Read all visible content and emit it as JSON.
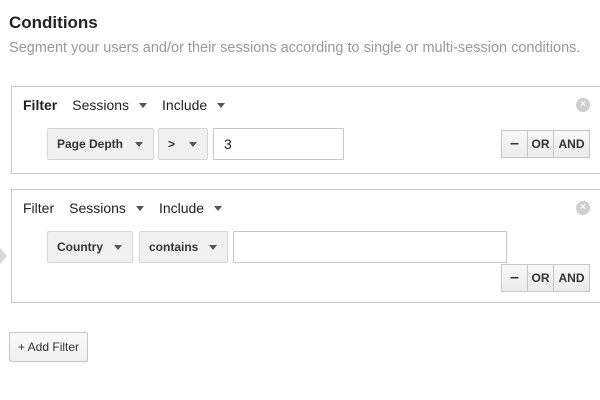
{
  "header": {
    "title": "Conditions",
    "subtitle": "Segment your users and/or their sessions according to single or multi-session conditions."
  },
  "filters": [
    {
      "label": "Filter",
      "scope": "Sessions",
      "mode": "Include",
      "dimension": "Page Depth",
      "operator": ">",
      "value": "3",
      "value_placeholder": "",
      "buttons": {
        "remove": "–",
        "or": "OR",
        "and": "AND"
      }
    },
    {
      "label": "Filter",
      "scope": "Sessions",
      "mode": "Include",
      "dimension": "Country",
      "operator": "contains",
      "value": "",
      "value_placeholder": "",
      "buttons": {
        "remove": "–",
        "or": "OR",
        "and": "AND"
      }
    }
  ],
  "add_filter_label": "+ Add Filter",
  "icons": {
    "close": "close-circle-icon",
    "dropdown": "caret-down-icon"
  },
  "colors": {
    "subtitle": "#999999",
    "border": "#c8c8c8",
    "select_bg": "#f1f1f1"
  }
}
